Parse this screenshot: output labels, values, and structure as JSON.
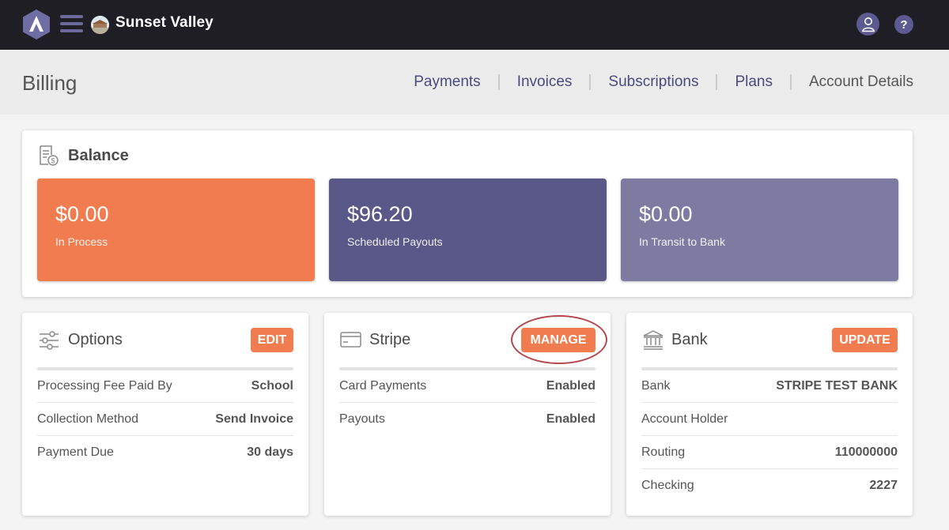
{
  "topbar": {
    "school_name": "Sunset Valley",
    "help_label": "?"
  },
  "header": {
    "title": "Billing",
    "nav": [
      "Payments",
      "Invoices",
      "Subscriptions",
      "Plans",
      "Account Details"
    ]
  },
  "balance": {
    "title": "Balance",
    "tiles": [
      {
        "amount": "$0.00",
        "label": "In Process",
        "color": "#f07c4f"
      },
      {
        "amount": "$96.20",
        "label": "Scheduled Payouts",
        "color": "#5a5888"
      },
      {
        "amount": "$0.00",
        "label": "In Transit to Bank",
        "color": "#7d7ba2"
      }
    ]
  },
  "options": {
    "title": "Options",
    "button": "EDIT",
    "rows": [
      {
        "label": "Processing Fee Paid By",
        "value": "School"
      },
      {
        "label": "Collection Method",
        "value": "Send Invoice"
      },
      {
        "label": "Payment Due",
        "value": "30 days"
      }
    ]
  },
  "stripe": {
    "title": "Stripe",
    "button": "MANAGE",
    "rows": [
      {
        "label": "Card Payments",
        "value": "Enabled"
      },
      {
        "label": "Payouts",
        "value": "Enabled"
      }
    ]
  },
  "bank": {
    "title": "Bank",
    "button": "UPDATE",
    "rows": [
      {
        "label": "Bank",
        "value": "STRIPE TEST BANK"
      },
      {
        "label": "Account Holder",
        "value": ""
      },
      {
        "label": "Routing",
        "value": "110000000"
      },
      {
        "label": "Checking",
        "value": "2227"
      }
    ]
  },
  "colors": {
    "topbar": "#1e1e24",
    "accent_orange": "#f07c4f",
    "accent_purple": "#5a5888",
    "annotation_ring": "#b5464c"
  },
  "icons": {
    "logo": "app-logo-a",
    "menu": "hamburger-icon",
    "user": "user-icon",
    "help": "help-icon",
    "balance": "receipt-dollar-icon",
    "options": "sliders-icon",
    "stripe": "credit-card-icon",
    "bank": "bank-icon"
  }
}
